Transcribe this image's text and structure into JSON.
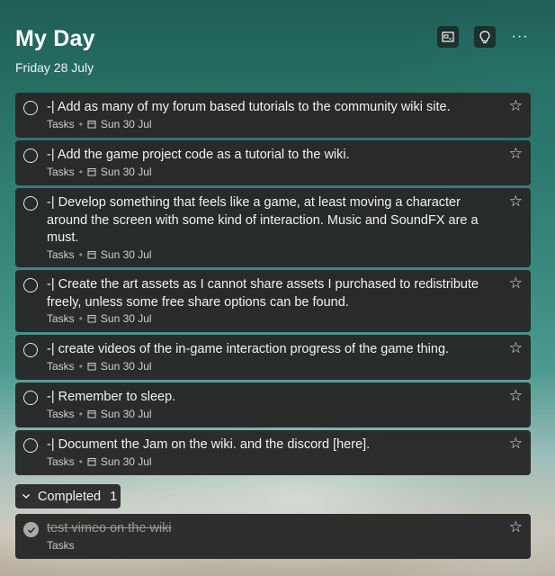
{
  "header": {
    "title": "My Day",
    "date": "Friday 28 July",
    "buttons": {
      "background": "background-icon",
      "suggestions": "lightbulb-icon",
      "more": "···"
    }
  },
  "tasks": [
    {
      "title": "-| Add as many of my forum based tutorials to the community wiki site.",
      "list": "Tasks",
      "due": "Sun 30 Jul"
    },
    {
      "title": "-| Add the game project code as a tutorial to the wiki.",
      "list": "Tasks",
      "due": "Sun 30 Jul"
    },
    {
      "title": "-| Develop something that feels like a game, at least moving a character around the screen with some kind of interaction. Music and SoundFX are a must.",
      "list": "Tasks",
      "due": "Sun 30 Jul"
    },
    {
      "title": "-| Create the art assets as I cannot share assets I purchased to redistribute freely, unless some free share options can be found.",
      "list": "Tasks",
      "due": "Sun 30 Jul"
    },
    {
      "title": "-| create videos of the in-game interaction progress of the game thing.",
      "list": "Tasks",
      "due": "Sun 30 Jul"
    },
    {
      "title": "-| Remember to sleep.",
      "list": "Tasks",
      "due": "Sun 30 Jul"
    },
    {
      "title": "-| Document the Jam on the wiki. and the discord [here].",
      "list": "Tasks",
      "due": "Sun 30 Jul"
    }
  ],
  "completed": {
    "label": "Completed",
    "count": "1",
    "items": [
      {
        "title": "test vimeo on the wiki",
        "list": "Tasks"
      }
    ]
  },
  "colors": {
    "card": "#282828",
    "text": "#f2f2f2",
    "meta": "#cfcfcf"
  }
}
